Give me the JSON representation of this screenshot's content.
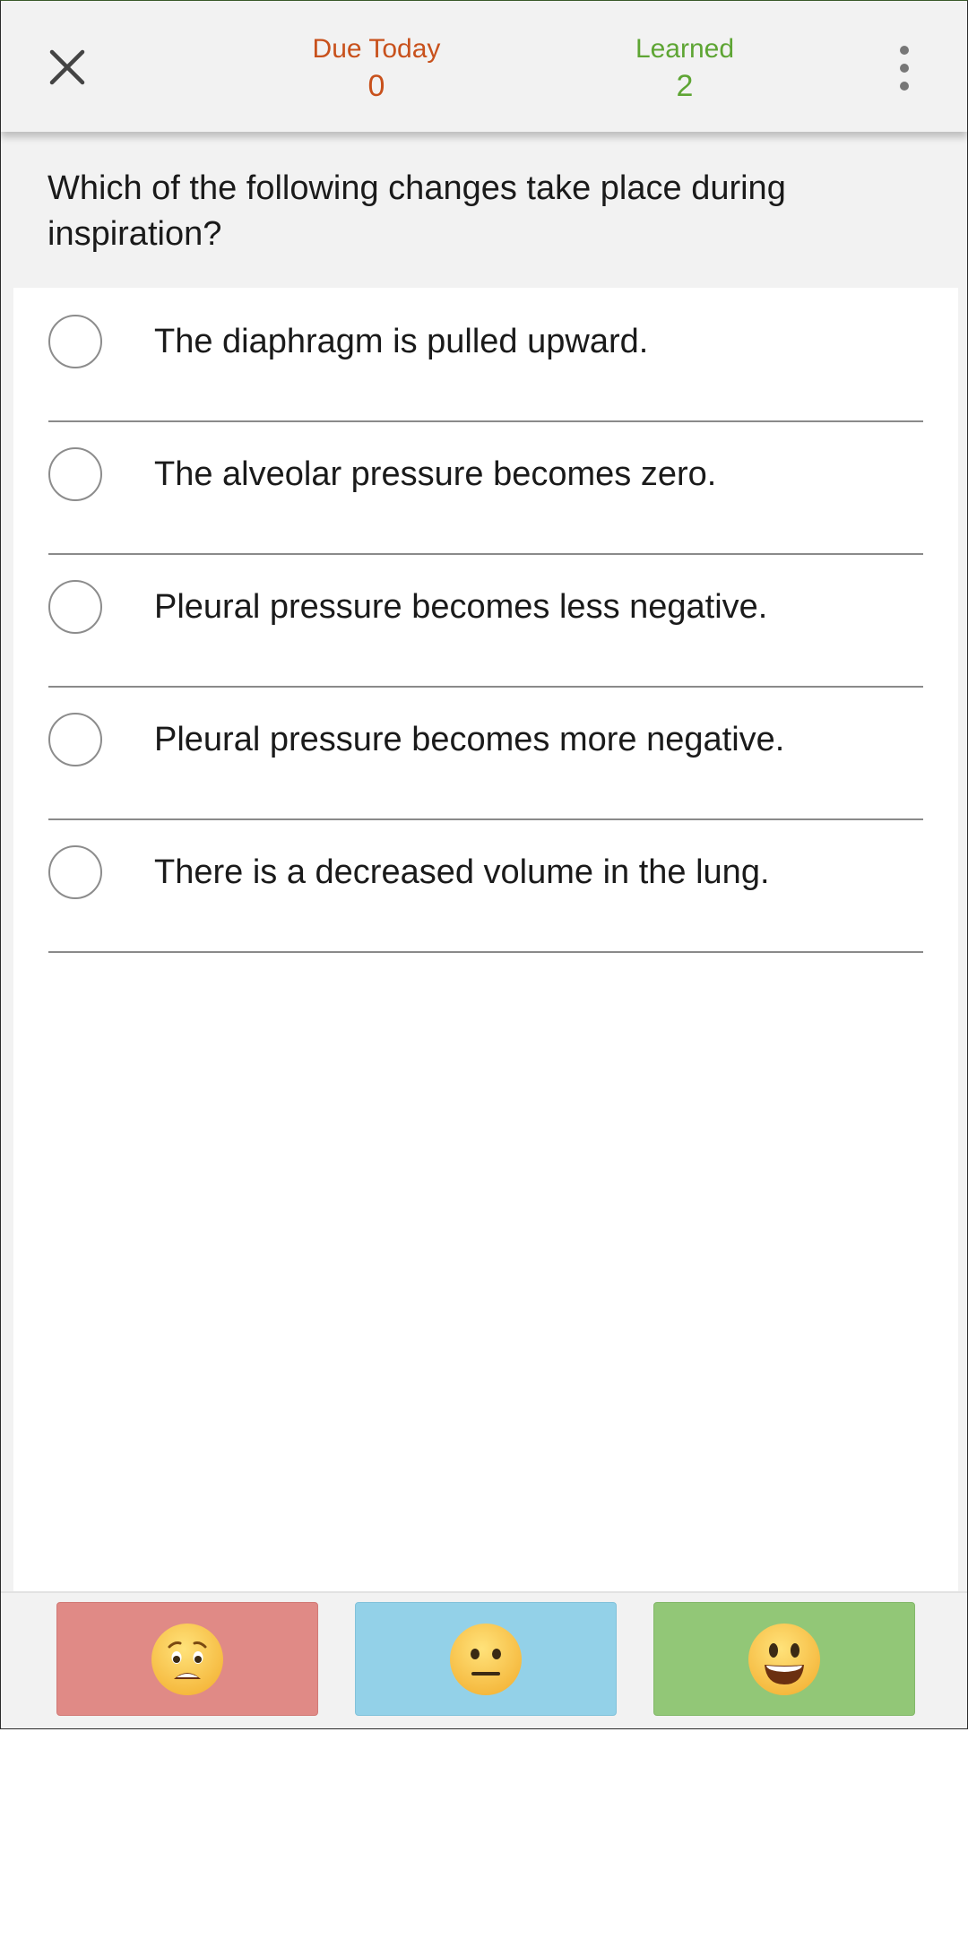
{
  "header": {
    "due_today_label": "Due Today",
    "due_today_value": "0",
    "learned_label": "Learned",
    "learned_value": "2"
  },
  "question": "Which of the following changes take place during inspiration?",
  "options": [
    {
      "text": "The diaphragm is pulled upward."
    },
    {
      "text": "The alveolar pressure becomes zero."
    },
    {
      "text": "Pleural pressure becomes less negative."
    },
    {
      "text": "Pleural pressure becomes more negative."
    },
    {
      "text": "There is a decreased volume in the lung."
    }
  ],
  "rating_buttons": [
    {
      "icon": "worried-face-icon",
      "color": "#e08a86"
    },
    {
      "icon": "neutral-face-icon",
      "color": "#93d1e8"
    },
    {
      "icon": "happy-face-icon",
      "color": "#92c777"
    }
  ],
  "colors": {
    "due_today": "#c8511c",
    "learned": "#5ea534"
  }
}
